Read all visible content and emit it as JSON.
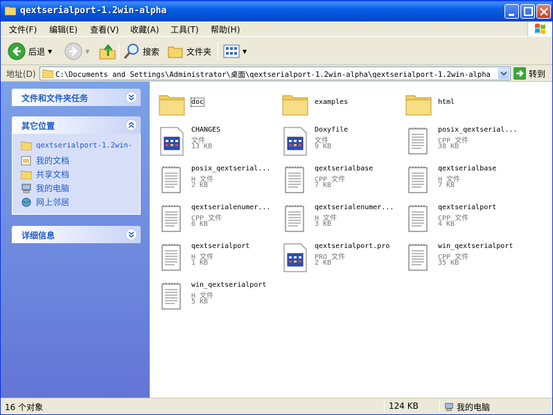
{
  "window": {
    "title": "qextserialport-1.2win-alpha"
  },
  "menu": {
    "items": [
      {
        "label": "文件(F)"
      },
      {
        "label": "编辑(E)"
      },
      {
        "label": "查看(V)"
      },
      {
        "label": "收藏(A)"
      },
      {
        "label": "工具(T)"
      },
      {
        "label": "帮助(H)"
      }
    ]
  },
  "toolbar": {
    "back_label": "后退",
    "search_label": "搜索",
    "folders_label": "文件夹"
  },
  "address": {
    "label": "地址(D)",
    "value": "C:\\Documents and Settings\\Administrator\\桌面\\qextserialport-1.2win-alpha\\qextserialport-1.2win-alpha",
    "go_label": "转到"
  },
  "taskpane": {
    "panels": [
      {
        "title": "文件和文件夹任务"
      },
      {
        "title": "其它位置",
        "items": [
          {
            "label": "qextserialport-1.2win-",
            "icon": "folder-icon"
          },
          {
            "label": "我的文档",
            "icon": "my-documents-icon"
          },
          {
            "label": "共享文档",
            "icon": "folder-icon"
          },
          {
            "label": "我的电脑",
            "icon": "my-computer-icon"
          },
          {
            "label": "网上邻居",
            "icon": "network-places-icon"
          }
        ]
      },
      {
        "title": "详细信息"
      }
    ]
  },
  "files": [
    {
      "name": "doc",
      "kind": "folder",
      "type": "",
      "size": ""
    },
    {
      "name": "examples",
      "kind": "folder",
      "type": "",
      "size": ""
    },
    {
      "name": "html",
      "kind": "folder",
      "type": "",
      "size": ""
    },
    {
      "name": "CHANGES",
      "kind": "app",
      "type": "文件",
      "size": "13 KB"
    },
    {
      "name": "Doxyfile",
      "kind": "app",
      "type": "文件",
      "size": "9 KB"
    },
    {
      "name": "posix_qextserial...",
      "kind": "text",
      "type": "CPP 文件",
      "size": "38 KB"
    },
    {
      "name": "posix_qextserial...",
      "kind": "text",
      "type": "H 文件",
      "size": "2 KB"
    },
    {
      "name": "qextserialbase",
      "kind": "text",
      "type": "CPP 文件",
      "size": "7 KB"
    },
    {
      "name": "qextserialbase",
      "kind": "text",
      "type": "H 文件",
      "size": "7 KB"
    },
    {
      "name": "qextserialenumer...",
      "kind": "text",
      "type": "CPP 文件",
      "size": "6 KB"
    },
    {
      "name": "qextserialenumer...",
      "kind": "text",
      "type": "H 文件",
      "size": "3 KB"
    },
    {
      "name": "qextserialport",
      "kind": "text",
      "type": "CPP 文件",
      "size": "4 KB"
    },
    {
      "name": "qextserialport",
      "kind": "text",
      "type": "H 文件",
      "size": "1 KB"
    },
    {
      "name": "qextserialport.pro",
      "kind": "app",
      "type": "PRO 文件",
      "size": "2 KB"
    },
    {
      "name": "win_qextserialport",
      "kind": "text",
      "type": "CPP 文件",
      "size": "35 KB"
    },
    {
      "name": "win_qextserialport",
      "kind": "text",
      "type": "H 文件",
      "size": "5 KB"
    }
  ],
  "statusbar": {
    "count": "16 个对象",
    "size": "124 KB",
    "location": "我的电脑"
  },
  "colors": {
    "titlebar": "#0a5fe8",
    "taskpane": "#7ba2e7",
    "link": "#215dc6"
  }
}
